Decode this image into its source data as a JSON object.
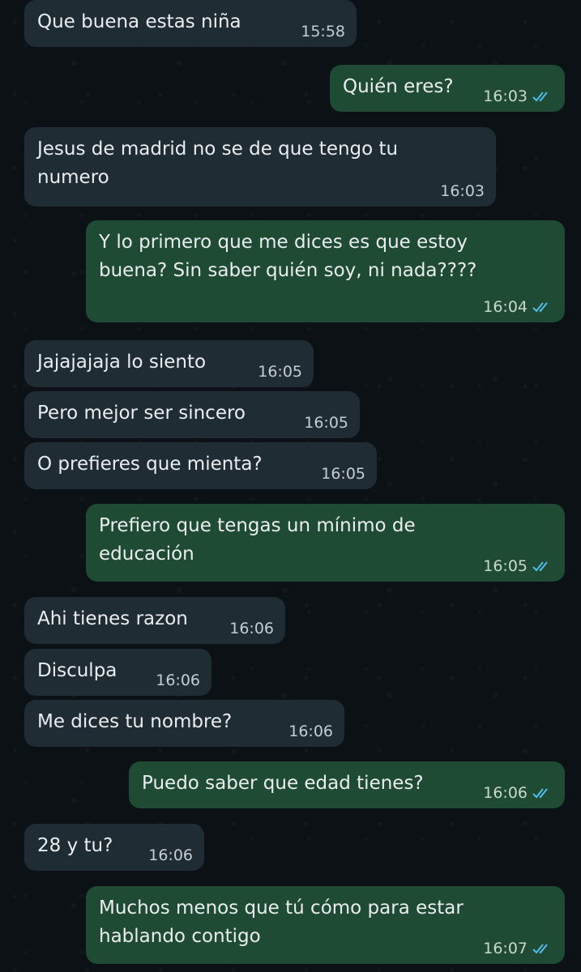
{
  "colors": {
    "background": "#0b1114",
    "incoming_bubble": "#202c33",
    "outgoing_bubble": "#1f4a33",
    "read_ticks": "#53bdeb"
  },
  "messages": [
    {
      "dir": "in",
      "text": "Que buena estas niña",
      "time": "15:58"
    },
    {
      "dir": "out",
      "text": "Quién eres?",
      "time": "16:03",
      "status": "read-double-check-icon"
    },
    {
      "dir": "in",
      "text": "Jesus de madrid no se de que tengo tu\nnumero",
      "time": "16:03"
    },
    {
      "dir": "out",
      "text": "Y lo primero que me dices es que estoy\nbuena? Sin saber quién soy, ni nada????",
      "time": "16:04",
      "status": "read-double-check-icon"
    },
    {
      "dir": "in",
      "text": "Jajajajaja lo siento",
      "time": "16:05"
    },
    {
      "dir": "in",
      "text": "Pero mejor ser sincero",
      "time": "16:05"
    },
    {
      "dir": "in",
      "text": "O prefieres que mienta?",
      "time": "16:05"
    },
    {
      "dir": "out",
      "text": "Prefiero que tengas un mínimo de\neducación",
      "time": "16:05",
      "status": "read-double-check-icon"
    },
    {
      "dir": "in",
      "text": "Ahi tienes razon",
      "time": "16:06"
    },
    {
      "dir": "in",
      "text": "Disculpa",
      "time": "16:06"
    },
    {
      "dir": "in",
      "text": "Me dices tu nombre?",
      "time": "16:06"
    },
    {
      "dir": "out",
      "text": "Puedo saber que edad tienes?",
      "time": "16:06",
      "status": "read-double-check-icon"
    },
    {
      "dir": "in",
      "text": "28 y tu?",
      "time": "16:06"
    },
    {
      "dir": "out",
      "text": "Muchos menos que tú cómo para estar\nhablando contigo",
      "time": "16:07",
      "status": "read-double-check-icon"
    }
  ]
}
